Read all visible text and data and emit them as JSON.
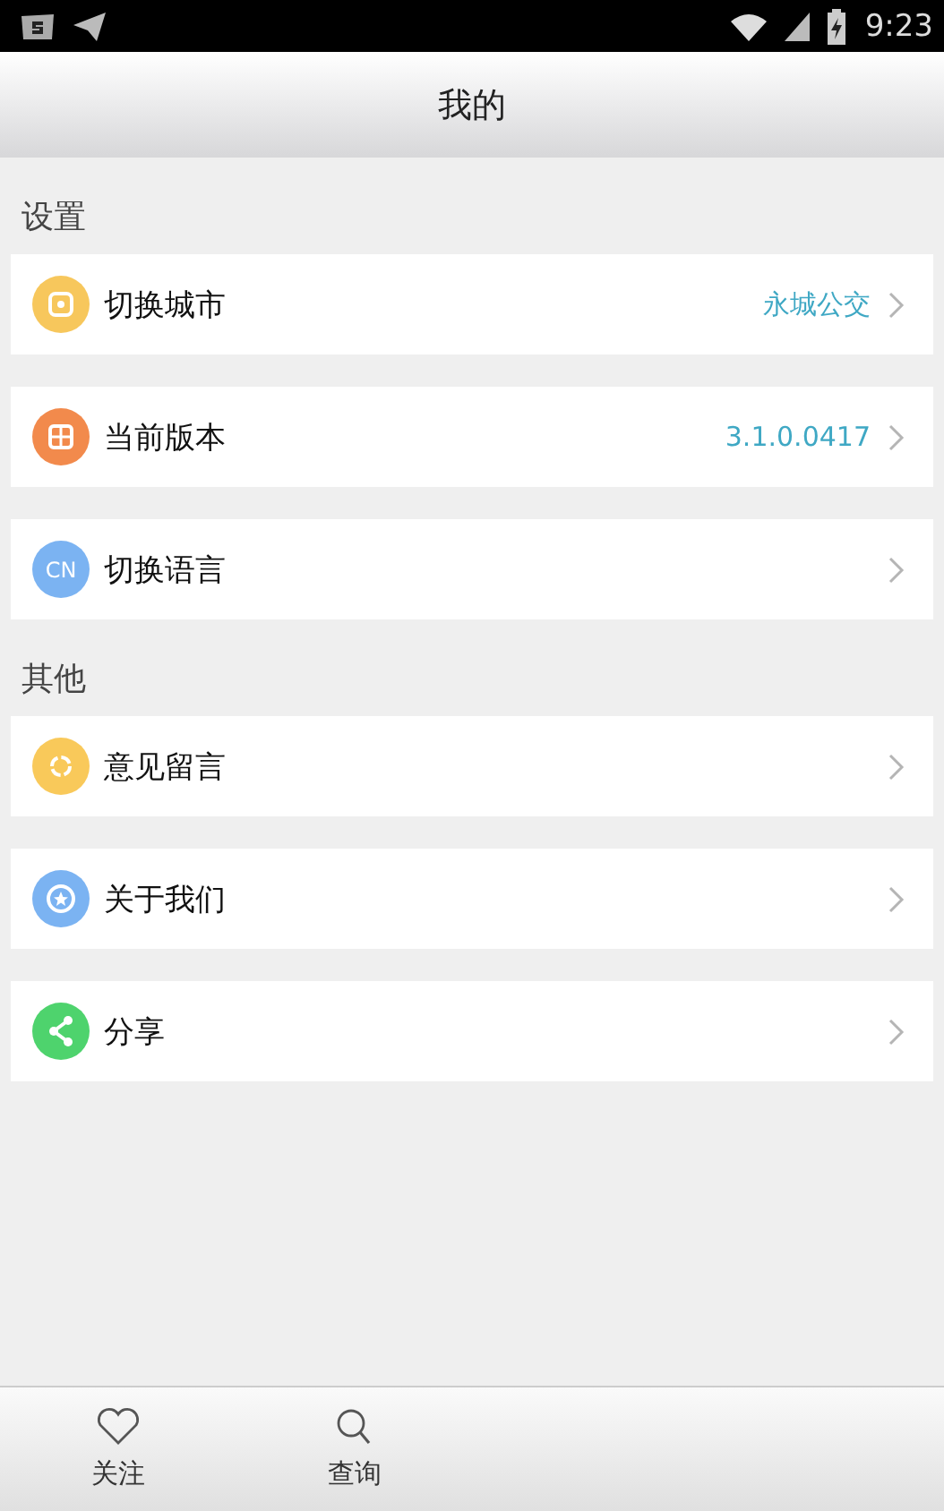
{
  "status_bar": {
    "time": "9:23"
  },
  "header": {
    "title": "我的"
  },
  "sections": [
    {
      "title": "设置",
      "items": [
        {
          "label": "切换城市",
          "value": "永城公交",
          "kind": "city",
          "color": "#f7c75c"
        },
        {
          "label": "当前版本",
          "value": "3.1.0.0417",
          "kind": "version",
          "color": "#f28a4c"
        },
        {
          "label": "切换语言",
          "kind": "language",
          "icon_text": "CN",
          "color": "#7bb3f2"
        }
      ]
    },
    {
      "title": "其他",
      "items": [
        {
          "label": "意见留言",
          "kind": "feedback",
          "color": "#f9c95a"
        },
        {
          "label": "关于我们",
          "kind": "about",
          "color": "#7bb3f2"
        },
        {
          "label": "分享",
          "kind": "share",
          "color": "#4ed36d"
        }
      ]
    }
  ],
  "tab_bar": [
    {
      "label": "关注",
      "kind": "heart"
    },
    {
      "label": "查询",
      "kind": "search"
    }
  ]
}
